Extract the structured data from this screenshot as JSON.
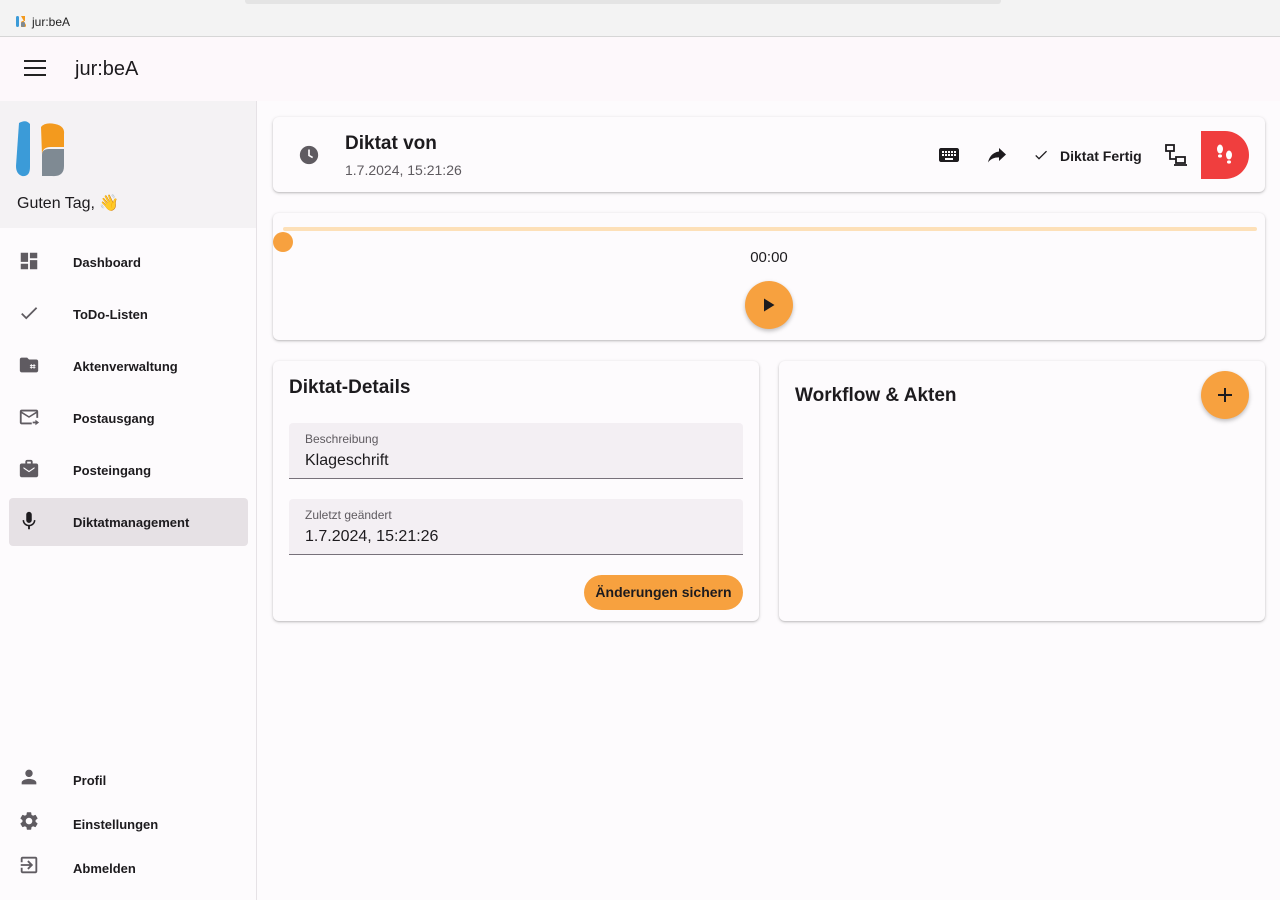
{
  "window": {
    "title": "jur:beA"
  },
  "appbar": {
    "title": "jur:beA",
    "menu_icon": "hamburger-menu-icon"
  },
  "sidebar": {
    "greeting": "Guten Tag, 👋",
    "items": [
      {
        "label": "Dashboard",
        "icon": "dashboard-icon",
        "active": false
      },
      {
        "label": "ToDo-Listen",
        "icon": "check-icon",
        "active": false
      },
      {
        "label": "Aktenverwaltung",
        "icon": "folder-hash-icon",
        "active": false
      },
      {
        "label": "Postausgang",
        "icon": "outgoing-mail-icon",
        "active": false
      },
      {
        "label": "Posteingang",
        "icon": "inbox-icon",
        "active": false
      },
      {
        "label": "Diktatmanagement",
        "icon": "microphone-icon",
        "active": true
      }
    ],
    "bottom_items": [
      {
        "label": "Profil",
        "icon": "person-icon"
      },
      {
        "label": "Einstellungen",
        "icon": "gear-icon"
      },
      {
        "label": "Abmelden",
        "icon": "logout-icon"
      }
    ]
  },
  "dictation": {
    "title": "Diktat von",
    "timestamp": "1.7.2024, 15:21:26",
    "actions": {
      "keyboard_icon": "keyboard-icon",
      "forward_icon": "forward-arrow-icon",
      "done_label": "Diktat Fertig",
      "transfer_icon": "device-transfer-icon",
      "footsteps_icon": "footsteps-icon"
    }
  },
  "player": {
    "time": "00:00",
    "progress": 0,
    "play_icon": "play-icon"
  },
  "details": {
    "title": "Diktat-Details",
    "fields": [
      {
        "label": "Beschreibung",
        "value": "Klageschrift"
      },
      {
        "label": "Zuletzt geändert",
        "value": "1.7.2024, 15:21:26"
      }
    ],
    "save_label": "Änderungen sichern"
  },
  "workflow": {
    "title": "Workflow & Akten",
    "add_icon": "plus-icon"
  },
  "colors": {
    "accent": "#f7a13f",
    "danger": "#f03e3e",
    "active_nav": "#e6e1e5",
    "logo_blue": "#3b9bd8",
    "logo_orange": "#f39a1e"
  }
}
